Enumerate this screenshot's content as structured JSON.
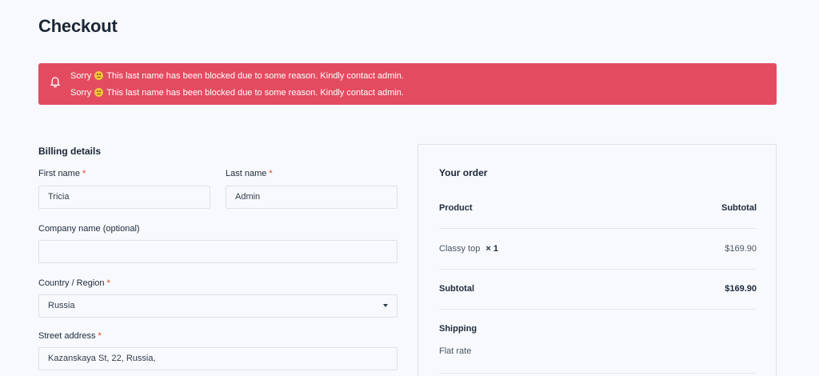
{
  "page": {
    "title": "Checkout"
  },
  "notice": {
    "messages": [
      {
        "before": "Sorry",
        "emoji": "sad-face",
        "after": "This last name has been blocked due to some reason. Kindly contact admin."
      },
      {
        "before": "Sorry",
        "emoji": "sad-face",
        "after": "This last name has been blocked due to some reason. Kindly contact admin."
      }
    ],
    "icon": "bell-icon",
    "background": "#e34c60"
  },
  "billing": {
    "title": "Billing details",
    "required_mark": "*",
    "first_name": {
      "label": "First name",
      "value": "Tricia"
    },
    "last_name": {
      "label": "Last name",
      "value": "Admin"
    },
    "company": {
      "label": "Company name (optional)",
      "value": ""
    },
    "country": {
      "label": "Country / Region",
      "value": "Russia"
    },
    "street": {
      "label": "Street address",
      "value": "Kazanskaya St, 22, Russia,"
    }
  },
  "order": {
    "title": "Your order",
    "header": {
      "product": "Product",
      "subtotal": "Subtotal"
    },
    "items": [
      {
        "name": "Classy top",
        "qty": "× 1",
        "price": "$169.90"
      }
    ],
    "subtotal": {
      "label": "Subtotal",
      "value": "$169.90"
    },
    "shipping": {
      "label": "Shipping",
      "method": "Flat rate"
    }
  }
}
